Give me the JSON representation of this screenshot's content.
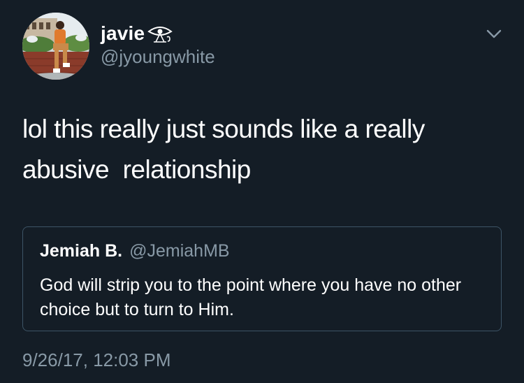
{
  "colors": {
    "background": "#141d26",
    "primary_text": "#ffffff",
    "secondary_text": "#8899a6",
    "card_border": "#3d5466"
  },
  "author": {
    "display_name": "javie",
    "name_emoji_icon": "eye-triangle-emoji-icon",
    "handle": "@jyoungwhite",
    "avatar_icon": "profile-photo"
  },
  "menu": {
    "icon": "chevron-down-icon"
  },
  "tweet": {
    "text": "lol this really just sounds like a really\nabusive  relationship"
  },
  "quoted_tweet": {
    "author_name": "Jemiah B.",
    "author_handle": "@JemiahMB",
    "text": "God will strip you to the point where you have no other choice but to turn to Him."
  },
  "timestamp": "9/26/17, 12:03 PM"
}
